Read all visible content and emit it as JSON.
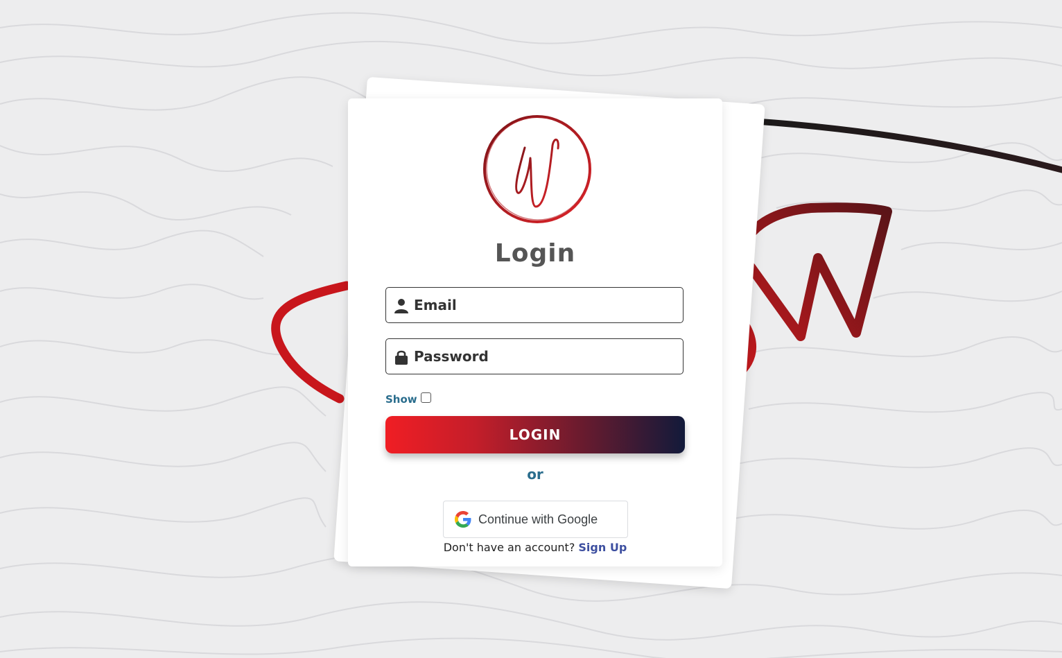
{
  "login": {
    "title": "Login",
    "email_placeholder": "Email",
    "password_placeholder": "Password",
    "show_label": "Show",
    "show_checked": false,
    "login_button": "LOGIN",
    "or_text": "or",
    "google_button": "Continue with Google",
    "signup_prompt": "Don't have an account?",
    "signup_link": "Sign Up"
  },
  "icons": {
    "email_field": "user-icon",
    "password_field": "lock-icon",
    "google": "google-icon",
    "logo": "w-logo"
  },
  "colors": {
    "accent_red": "#f01e24",
    "accent_navy": "#121a3a",
    "link_blue": "#3d4fa0",
    "teal_text": "#2a6d8d",
    "title_gray": "#555555"
  }
}
